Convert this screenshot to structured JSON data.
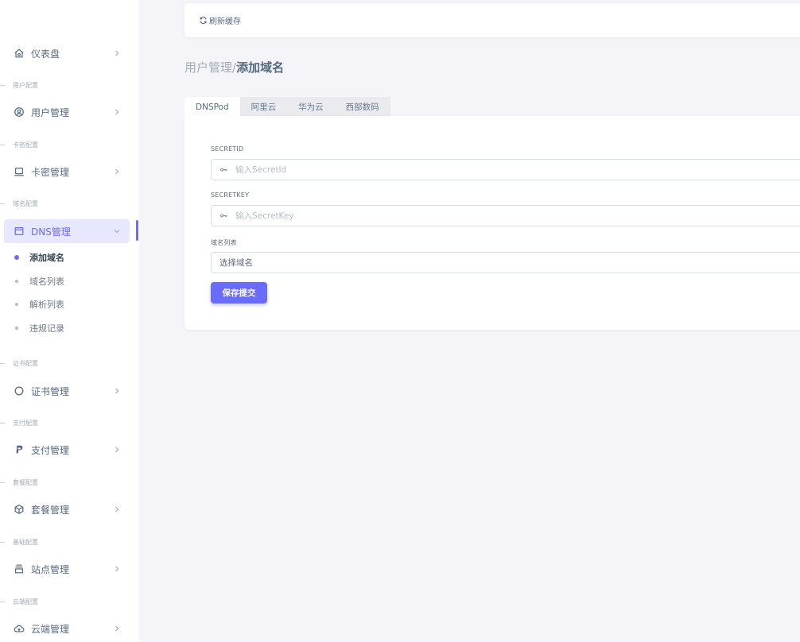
{
  "sidebar": {
    "dashboard": "仪表盘",
    "sections": {
      "user": "用户配置",
      "card": "卡密配置",
      "domain": "域名配置",
      "cert": "证书配置",
      "pay": "支付配置",
      "plan": "套餐配置",
      "base": "基础配置",
      "cloud": "云端配置"
    },
    "items": {
      "user_mgmt": "用户管理",
      "card_mgmt": "卡密管理",
      "dns_mgmt": "DNS管理",
      "cert_mgmt": "证书管理",
      "pay_mgmt": "支付管理",
      "plan_mgmt": "套餐管理",
      "site_mgmt": "站点管理",
      "cloud_mgmt": "云端管理"
    },
    "dns_sub": [
      "添加域名",
      "域名列表",
      "解析列表",
      "违规记录"
    ]
  },
  "topbar": {
    "refresh_label": "刷新缓存"
  },
  "breadcrumb": {
    "parent": "用户管理/",
    "current": "添加域名"
  },
  "tabs": [
    "DNSPod",
    "阿里云",
    "华为云",
    "西部数码"
  ],
  "form": {
    "secret_id_label": "SECRETID",
    "secret_id_placeholder": "输入SecretId",
    "secret_key_label": "SECRETKEY",
    "secret_key_placeholder": "输入SecretKey",
    "domain_list_label": "域名列表",
    "domain_select_value": "选择域名",
    "submit_label": "保存提交"
  },
  "colors": {
    "accent": "#696cff",
    "active_bg": "#e7e7ff",
    "page_bg": "#f5f5f9"
  }
}
